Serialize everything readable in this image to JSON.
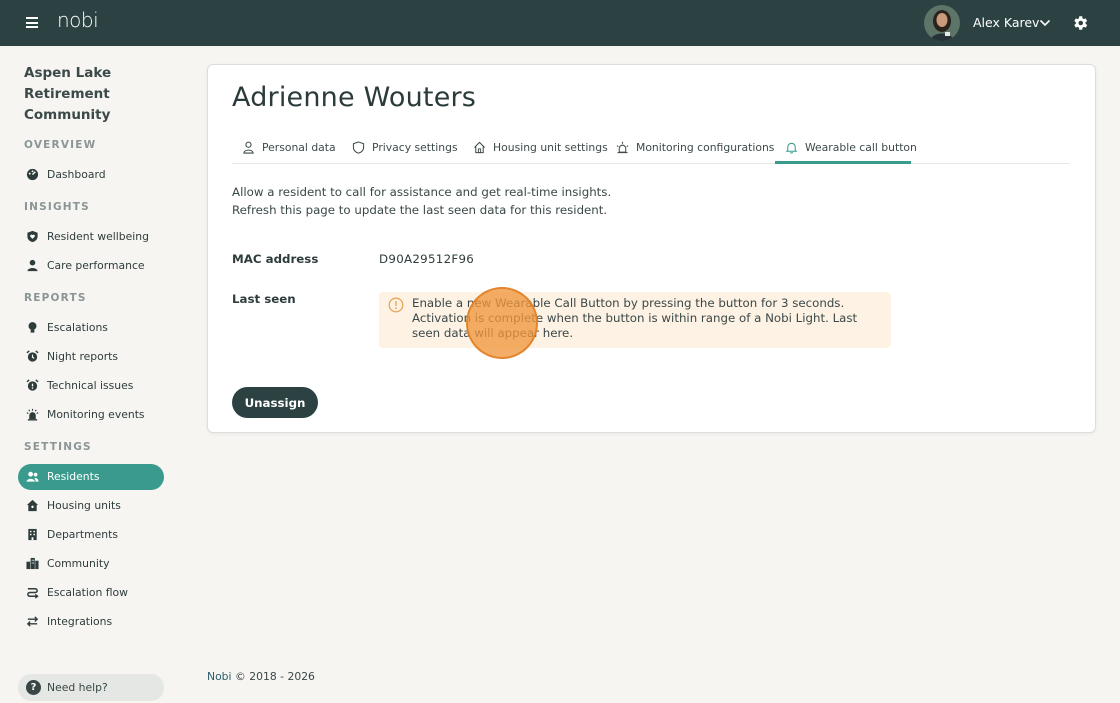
{
  "topbar": {
    "logo": "nobi",
    "user_name": "Alex Karev",
    "icons": {
      "menu": "hamburger-icon",
      "chevron": "chevron-down-icon",
      "settings": "gear-icon"
    }
  },
  "sidebar": {
    "community": "Aspen Lake Retirement Community",
    "sections": {
      "overview": "OVERVIEW",
      "insights": "INSIGHTS",
      "reports": "REPORTS",
      "settings": "SETTINGS"
    },
    "items": {
      "dashboard": "Dashboard",
      "resident_wellbeing": "Resident wellbeing",
      "care_performance": "Care performance",
      "escalations": "Escalations",
      "night_reports": "Night reports",
      "technical_issues": "Technical issues",
      "monitoring_events": "Monitoring events",
      "residents": "Residents",
      "housing_units": "Housing units",
      "departments": "Departments",
      "community": "Community",
      "escalation_flow": "Escalation flow",
      "integrations": "Integrations"
    },
    "active_item": "Residents",
    "help": "Need help?"
  },
  "main": {
    "title": "Adrienne Wouters",
    "tabs": {
      "personal": "Personal data",
      "privacy": "Privacy settings",
      "housing": "Housing unit settings",
      "monitoring": "Monitoring configurations",
      "wearable": "Wearable call button"
    },
    "active_tab": "Wearable call button",
    "intro_line1": "Allow a resident to call for assistance and get real-time insights.",
    "intro_line2": "Refresh this page to update the last seen data for this resident.",
    "mac_label": "MAC address",
    "mac_value": "D90A29512F96",
    "last_seen_label": "Last seen",
    "alert_text": "Enable a new Wearable Call Button by pressing the button for 3 seconds. Activation is complete when the button is within range of a Nobi Light. Last seen data will appear here.",
    "unassign_label": "Unassign"
  },
  "footer": {
    "brand": "Nobi",
    "copyright": "© 2018 - 2026"
  },
  "colors": {
    "topbar": "#2c4242",
    "accent": "#3b9a8e",
    "alert_bg": "#fdf2e4",
    "alert_icon": "#e8a55a"
  }
}
